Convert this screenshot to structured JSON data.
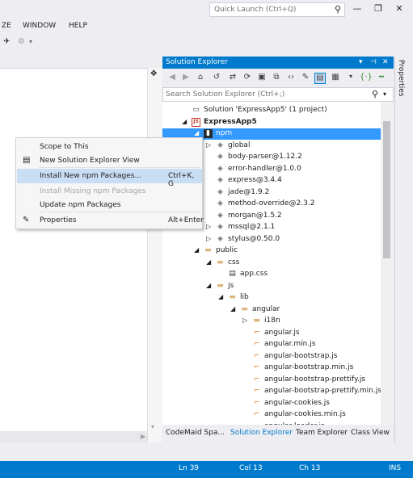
{
  "titlebar": {
    "quick_launch_placeholder": "Quick Launch (Ctrl+Q)",
    "minimize": "—",
    "restore": "❐",
    "close": "✕"
  },
  "menu": {
    "items": [
      "ZE",
      "WINDOW",
      "HELP"
    ]
  },
  "solution_explorer": {
    "title": "Solution Explorer",
    "header_buttons": [
      "▾",
      "⊣",
      "✕"
    ],
    "search_placeholder": "Search Solution Explorer (Ctrl+;)",
    "tree": [
      {
        "label": "Solution 'ExpressApp5' (1 project)",
        "level": 0,
        "arrow": "",
        "icon": "solution-icon",
        "bold": false
      },
      {
        "label": "ExpressApp5",
        "level": 0,
        "arrow": "◢",
        "icon": "js-project-icon",
        "bold": true
      },
      {
        "label": "npm",
        "level": 1,
        "arrow": "◢",
        "icon": "npm-icon",
        "selected": true
      },
      {
        "label": "global",
        "level": 2,
        "arrow": "▷",
        "icon": "package-icon"
      },
      {
        "label": "body-parser@1.12.2",
        "level": 2,
        "arrow": "",
        "icon": "package-icon"
      },
      {
        "label": "error-handler@1.0.0",
        "level": 2,
        "arrow": "",
        "icon": "package-icon"
      },
      {
        "label": "express@3.4.4",
        "level": 2,
        "arrow": "",
        "icon": "package-icon"
      },
      {
        "label": "jade@1.9.2",
        "level": 2,
        "arrow": "",
        "icon": "package-icon"
      },
      {
        "label": "method-override@2.3.2",
        "level": 2,
        "arrow": "",
        "icon": "package-icon"
      },
      {
        "label": "morgan@1.5.2",
        "level": 2,
        "arrow": "",
        "icon": "package-icon"
      },
      {
        "label": "mssql@2.1.1",
        "level": 2,
        "arrow": "▷",
        "icon": "package-icon"
      },
      {
        "label": "stylus@0.50.0",
        "level": 2,
        "arrow": "▷",
        "icon": "package-icon"
      },
      {
        "label": "public",
        "level": 1,
        "arrow": "◢",
        "icon": "folder-icon"
      },
      {
        "label": "css",
        "level": 2,
        "arrow": "◢",
        "icon": "folder-icon"
      },
      {
        "label": "app.css",
        "level": 3,
        "arrow": "",
        "icon": "css-file-icon"
      },
      {
        "label": "js",
        "level": 2,
        "arrow": "◢",
        "icon": "folder-icon"
      },
      {
        "label": "lib",
        "level": 3,
        "arrow": "◢",
        "icon": "folder-icon"
      },
      {
        "label": "angular",
        "level": 4,
        "arrow": "◢",
        "icon": "folder-icon"
      },
      {
        "label": "i18n",
        "level": 5,
        "arrow": "▷",
        "icon": "folder-icon"
      },
      {
        "label": "angular.js",
        "level": 5,
        "arrow": "",
        "icon": "js-file-icon"
      },
      {
        "label": "angular.min.js",
        "level": 5,
        "arrow": "",
        "icon": "js-file-icon"
      },
      {
        "label": "angular-bootstrap.js",
        "level": 5,
        "arrow": "",
        "icon": "js-file-icon"
      },
      {
        "label": "angular-bootstrap.min.js",
        "level": 5,
        "arrow": "",
        "icon": "js-file-icon"
      },
      {
        "label": "angular-bootstrap-prettify.js",
        "level": 5,
        "arrow": "",
        "icon": "js-file-icon"
      },
      {
        "label": "angular-bootstrap-prettify.min.js",
        "level": 5,
        "arrow": "",
        "icon": "js-file-icon"
      },
      {
        "label": "angular-cookies.js",
        "level": 5,
        "arrow": "",
        "icon": "js-file-icon"
      },
      {
        "label": "angular-cookies.min.js",
        "level": 5,
        "arrow": "",
        "icon": "js-file-icon"
      },
      {
        "label": "angular-loader.js",
        "level": 5,
        "arrow": "",
        "icon": "js-file-icon"
      }
    ],
    "tabs": [
      "CodeMaid Spa...",
      "Solution Explorer",
      "Team Explorer",
      "Class View"
    ]
  },
  "properties_panel": {
    "label": "Properties"
  },
  "context_menu": [
    {
      "label": "Scope to This",
      "shortcut": "",
      "disabled": false,
      "icon": ""
    },
    {
      "label": "New Solution Explorer View",
      "shortcut": "",
      "disabled": false,
      "icon": "new-view-icon"
    },
    {
      "label": "Install New npm Packages...",
      "shortcut": "Ctrl+K, G",
      "disabled": false,
      "icon": "",
      "hover": true
    },
    {
      "label": "Install Missing npm Packages",
      "shortcut": "",
      "disabled": true,
      "icon": ""
    },
    {
      "label": "Update npm Packages",
      "shortcut": "",
      "disabled": false,
      "icon": ""
    },
    {
      "label": "Properties",
      "shortcut": "Alt+Enter",
      "disabled": false,
      "icon": "wrench-icon"
    }
  ],
  "statusbar": {
    "ln": "Ln 39",
    "col": "Col 13",
    "ch": "Ch 13",
    "mode": "INS"
  },
  "colors": {
    "accent": "#007acc",
    "selection": "#3399ff",
    "menu_hover": "#c9def5"
  }
}
